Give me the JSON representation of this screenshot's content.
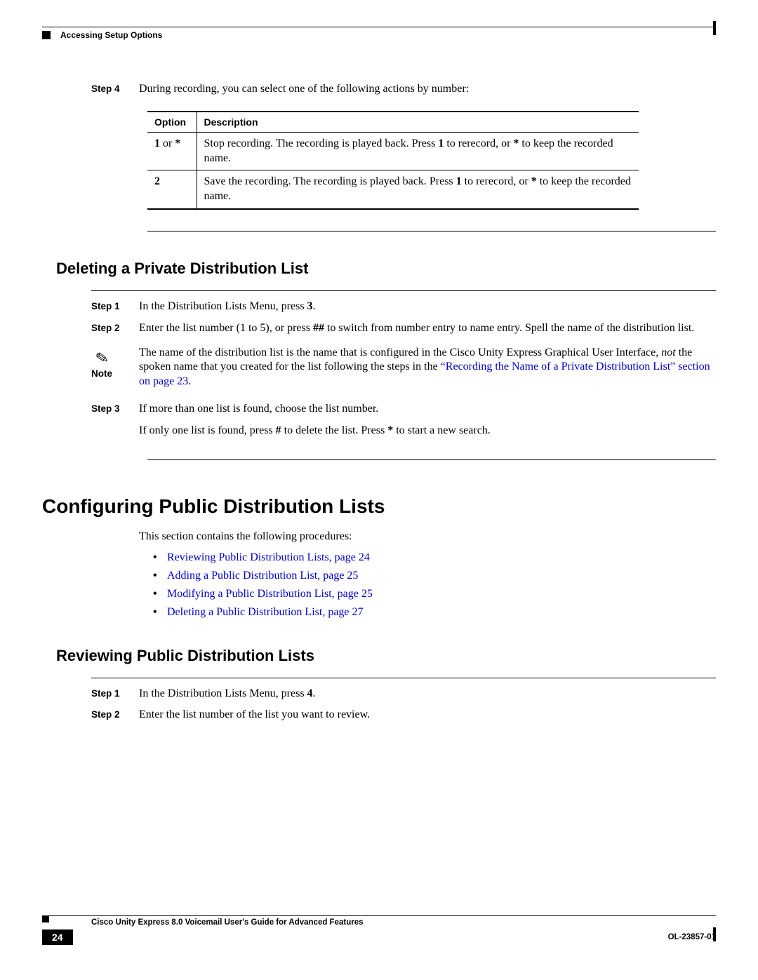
{
  "header": {
    "section_title": "Accessing Setup Options"
  },
  "step4": {
    "label": "Step 4",
    "text": "During recording, you can select one of the following actions by number:"
  },
  "table": {
    "headers": {
      "option": "Option",
      "description": "Description"
    },
    "rows": [
      {
        "option_pre": "1",
        "option_or": " or ",
        "option_post": "*",
        "desc_pre": "Stop recording. The recording is played back. Press ",
        "desc_b1": "1",
        "desc_mid": " to rerecord, or ",
        "desc_b2": "*",
        "desc_post": " to keep the recorded name."
      },
      {
        "option_pre": "2",
        "option_or": "",
        "option_post": "",
        "desc_pre": "Save the recording. The recording is played back. Press ",
        "desc_b1": "1",
        "desc_mid": " to rerecord, or ",
        "desc_b2": "*",
        "desc_post": " to keep the recorded name."
      }
    ]
  },
  "deleting": {
    "title": "Deleting a Private Distribution List",
    "step1": {
      "label": "Step 1",
      "pre": "In the Distribution Lists Menu, press ",
      "b": "3",
      "post": "."
    },
    "step2": {
      "label": "Step 2",
      "pre": "Enter the list number (1 to 5), or press ",
      "b": "##",
      "post": " to switch from number entry to name entry. Spell the name of the distribution list."
    },
    "note": {
      "label": "Note",
      "pre": "The name of the distribution list is the name that is configured in the Cisco Unity Express Graphical User Interface, ",
      "italic": "not",
      "mid": " the spoken name that you created for the list following the steps in the ",
      "link": "“Recording the Name of a Private Distribution List” section on page 23",
      "post": "."
    },
    "step3": {
      "label": "Step 3",
      "line1": "If more than one list is found, choose the list number.",
      "line2_pre": "If only one list is found, press ",
      "line2_b1": "#",
      "line2_mid": " to delete the list. Press ",
      "line2_b2": "*",
      "line2_post": " to start a new search."
    }
  },
  "configuring": {
    "title": "Configuring Public Distribution Lists",
    "intro": "This section contains the following procedures:",
    "bullets": [
      "Reviewing Public Distribution Lists, page 24",
      "Adding a Public Distribution List, page 25",
      "Modifying a Public Distribution List, page 25",
      "Deleting a Public Distribution List, page 27"
    ]
  },
  "reviewing": {
    "title": "Reviewing Public Distribution Lists",
    "step1": {
      "label": "Step 1",
      "pre": "In the Distribution Lists Menu, press ",
      "b": "4",
      "post": "."
    },
    "step2": {
      "label": "Step 2",
      "text": "Enter the list number of the list you want to review."
    }
  },
  "footer": {
    "doc_title": "Cisco Unity Express 8.0 Voicemail User's Guide for Advanced Features",
    "page_number": "24",
    "doc_id": "OL-23857-01"
  }
}
